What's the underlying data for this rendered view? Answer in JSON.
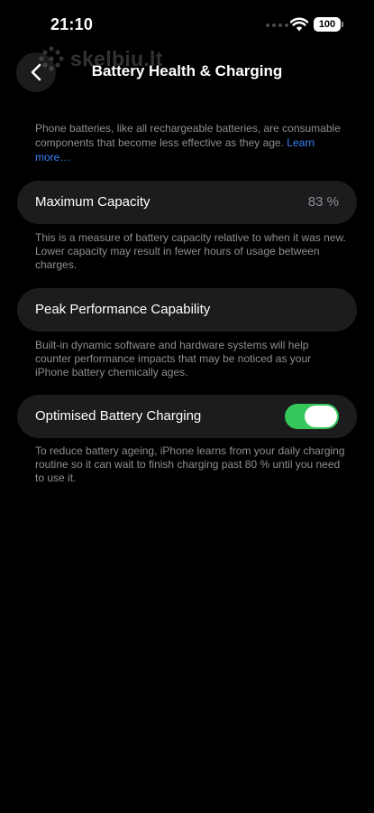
{
  "status_bar": {
    "time": "21:10",
    "battery_level": "100"
  },
  "watermark": {
    "text": "skelbiu.lt"
  },
  "nav": {
    "title": "Battery Health & Charging",
    "back_icon": "chevron-left-icon"
  },
  "intro": {
    "text": "Phone batteries, like all rechargeable batteries, are consumable components that become less effective as they age.",
    "link_label": "Learn more…"
  },
  "maximum_capacity": {
    "label": "Maximum Capacity",
    "value": "83 %",
    "footnote": "This is a measure of battery capacity relative to when it was new. Lower capacity may result in fewer hours of usage between charges."
  },
  "peak_performance": {
    "label": "Peak Performance Capability",
    "footnote": "Built-in dynamic software and hardware systems will help counter performance impacts that may be noticed as your iPhone battery chemically ages."
  },
  "optimised_charging": {
    "label": "Optimised Battery Charging",
    "enabled": true,
    "footnote": "To reduce battery ageing, iPhone learns from your daily charging routine so it can wait to finish charging past 80 % until you need to use it."
  },
  "colors": {
    "background": "#000000",
    "card": "#1c1c1e",
    "secondary_text": "#8e8e93",
    "link": "#3a82f7",
    "toggle_on": "#34c759"
  }
}
